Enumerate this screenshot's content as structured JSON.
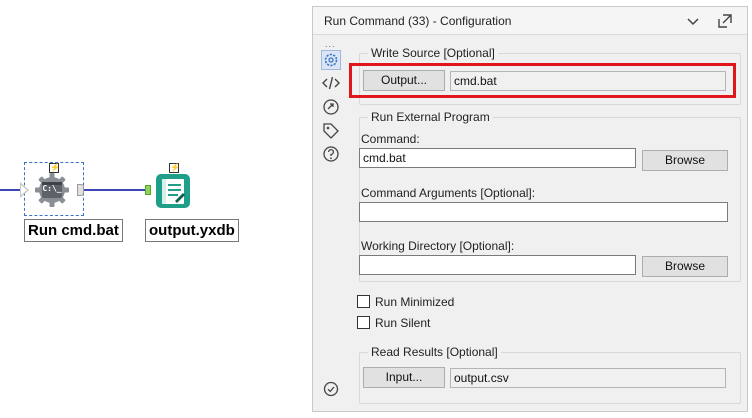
{
  "workflow": {
    "tools": [
      {
        "label": "Run cmd.bat",
        "icon": "run-command-gear-icon",
        "icon_text": "C:\\_"
      },
      {
        "label": "output.yxdb",
        "icon": "output-data-book-icon"
      }
    ],
    "connection_color": "#3f46b8",
    "error_icon": "lightning-icon",
    "error_glyph": "⚡"
  },
  "panel": {
    "title": "Run Command (33) - Configuration",
    "header_icons": [
      "chevron-down-icon",
      "popout-icon"
    ],
    "side_icons": [
      "gear-icon",
      "code-icon",
      "annotation-icon",
      "tag-icon",
      "help-icon"
    ],
    "side_dots": "...",
    "write_source": {
      "title": "Write Source [Optional]",
      "button": "Output...",
      "value": "cmd.bat"
    },
    "run_external": {
      "title": "Run External Program",
      "command_label": "Command:",
      "command_value": "cmd.bat",
      "browse1": "Browse",
      "args_label": "Command Arguments [Optional]:",
      "args_value": "",
      "workdir_label": "Working Directory [Optional]:",
      "workdir_value": "",
      "browse2": "Browse"
    },
    "run_minimized": {
      "label": "Run Minimized",
      "checked": false
    },
    "run_silent": {
      "label": "Run Silent",
      "checked": false
    },
    "read_results": {
      "title": "Read Results [Optional]",
      "button": "Input...",
      "value": "output.csv"
    },
    "highlight_color": "#e0161b",
    "accent": "#3b73c6"
  }
}
